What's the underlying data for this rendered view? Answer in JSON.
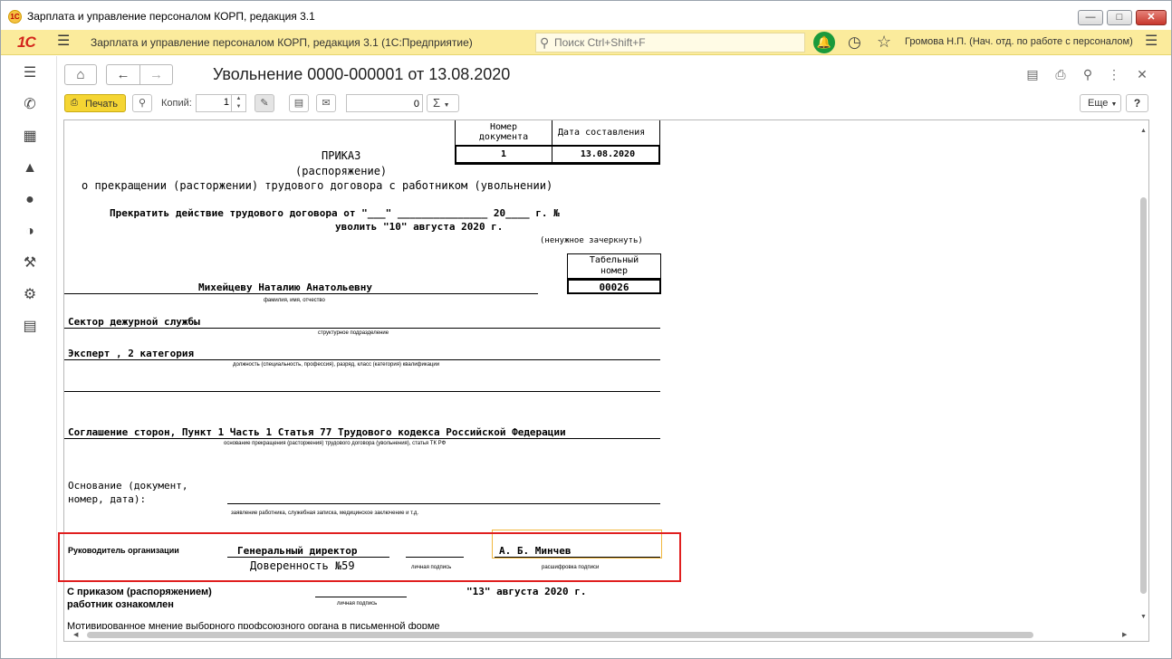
{
  "window": {
    "title": "Зарплата и управление персоналом КОРП, редакция 3.1",
    "logo_icon": "1c-logo-icon",
    "controls": [
      "minimize-icon",
      "maximize-icon",
      "close-icon"
    ]
  },
  "appbar": {
    "logo": "1С",
    "title": "Зарплата и управление персоналом КОРП, редакция 3.1  (1С:Предприятие)",
    "search_placeholder": "Поиск Ctrl+Shift+F",
    "user": "Громова Н.П. (Нач. отд. по работе с персоналом)",
    "accent": "#fbeb9c"
  },
  "sidebar": {
    "items": [
      "menu-icon",
      "phone-icon",
      "gift-icon",
      "graduation-cap-icon",
      "users-icon",
      "helmet-icon",
      "wrench-icon",
      "gear-icon",
      "id-card-icon"
    ]
  },
  "form": {
    "title": "Увольнение 0000-000001 от 13.08.2020"
  },
  "toolbar": {
    "print_label": "Печать",
    "copies_label": "Копий:",
    "copies_value": "1",
    "number_value": "0",
    "sum_label": "Σ",
    "more_label": "Еще",
    "help_label": "?"
  },
  "document": {
    "table_header_number": "Номер\nдокумента",
    "table_header_date": "Дата составления",
    "doc_number": "1",
    "doc_date": "13.08.2020",
    "title": "ПРИКАЗ",
    "subtitle": "(распоряжение)",
    "heading": "о прекращении (расторжении) трудового договора с работником (увольнении)",
    "contract_line": "Прекратить действие трудового договора от  \"___\" _______________ 20____ г. №",
    "dismiss_line": "уволить  \"10\" августа 2020 г.",
    "strike_note": "(ненужное зачеркнуть)",
    "tab_number_header": "Табельный\nномер",
    "tab_number": "00026",
    "employee": "Михейцеву Наталию Анатольевну",
    "employee_caption": "фамилия, имя, отчество",
    "department": "Сектор дежурной службы",
    "department_caption": "структурное подразделение",
    "position": "Эксперт , 2 категория",
    "position_caption": "должность (специальность, профессия), разряд, класс (категория) квалификации",
    "ground": "Соглашение сторон, Пункт 1 Часть 1 Статья 77 Трудового кодекса Российской Федерации",
    "ground_caption": "основание прекращения (расторжения) трудового договора (увольнения), статья ТК РФ",
    "basis_label": "Основание (документ,\nномер, дата):",
    "basis_caption": "заявление работника, служебная записка, медицинское заключение и т.д.",
    "head_label": "Руководитель организации",
    "head_position": "Генеральный директор",
    "power_of_attorney": "Доверенность №59",
    "signature_caption": "личная подпись",
    "head_name": "А. Б. Минчев",
    "decoding_caption": "расшифровка подписи",
    "ack_label": "С приказом (распоряжением)\nработник ознакомлен",
    "ack_signature_caption": "личная подпись",
    "ack_date": "\"13\" августа 2020 г.",
    "union_note": "Мотивированное мнение выборного профсоюзного органа в письменной форме"
  }
}
